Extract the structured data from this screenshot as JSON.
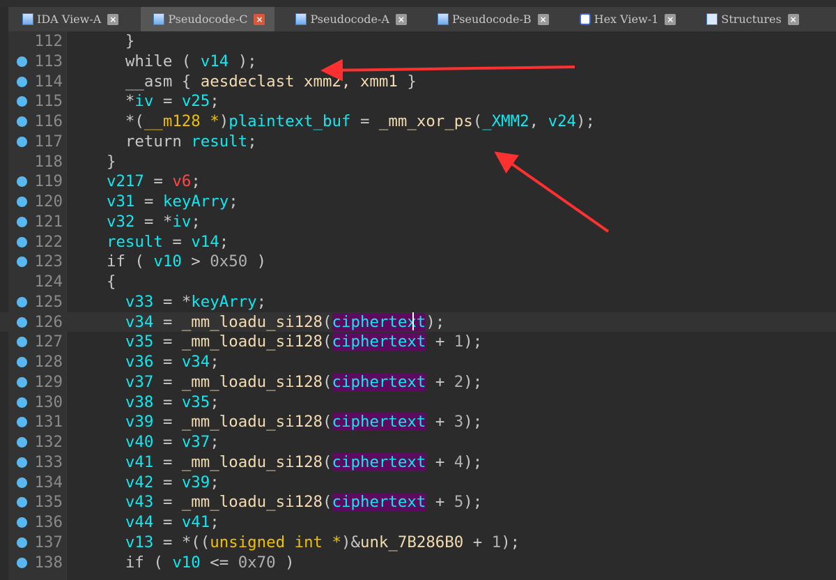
{
  "tabs": [
    {
      "label": "IDA View-A",
      "icon": "disassembly-icon",
      "active": false
    },
    {
      "label": "Pseudocode-C",
      "icon": "pseudocode-icon",
      "active": true
    },
    {
      "label": "Pseudocode-A",
      "icon": "pseudocode-icon",
      "active": false
    },
    {
      "label": "Pseudocode-B",
      "icon": "pseudocode-icon",
      "active": false
    },
    {
      "label": "Hex View-1",
      "icon": "hex-icon",
      "active": false
    },
    {
      "label": "Structures",
      "icon": "structures-icon",
      "active": false
    }
  ],
  "close_glyph": "×",
  "colors": {
    "background": "#2b2b2b",
    "variable": "#10e8f0",
    "function": "#f2dbb0",
    "type": "#f0c000",
    "highlight": "#5c0c5e",
    "breakpoint_dot": "#5ab8f0",
    "arrow": "#ff3030"
  },
  "current_line": 126,
  "lines": [
    {
      "num": "112",
      "dot": false,
      "indent": "    ",
      "tokens": [
        [
          "k",
          "}"
        ]
      ]
    },
    {
      "num": "113",
      "dot": true,
      "indent": "    ",
      "tokens": [
        [
          "k",
          "while ( "
        ],
        [
          "v",
          "v14"
        ],
        [
          "k",
          " );"
        ]
      ]
    },
    {
      "num": "114",
      "dot": true,
      "indent": "    ",
      "tokens": [
        [
          "k",
          "__asm { "
        ],
        [
          "f",
          "aesdeclast xmm2, xmm1"
        ],
        [
          "k",
          " }"
        ]
      ]
    },
    {
      "num": "115",
      "dot": true,
      "indent": "    ",
      "tokens": [
        [
          "k",
          "*"
        ],
        [
          "v",
          "iv"
        ],
        [
          "k",
          " = "
        ],
        [
          "v",
          "v25"
        ],
        [
          "k",
          ";"
        ]
      ]
    },
    {
      "num": "116",
      "dot": true,
      "indent": "    ",
      "tokens": [
        [
          "k",
          "*("
        ],
        [
          "t",
          "__m128 *"
        ],
        [
          "k",
          ")"
        ],
        [
          "v",
          "plaintext_buf"
        ],
        [
          "k",
          " = "
        ],
        [
          "f",
          "_mm_xor_ps"
        ],
        [
          "k",
          "("
        ],
        [
          "v",
          "_XMM2"
        ],
        [
          "k",
          ", "
        ],
        [
          "v",
          "v24"
        ],
        [
          "k",
          ");"
        ]
      ]
    },
    {
      "num": "117",
      "dot": true,
      "indent": "    ",
      "tokens": [
        [
          "k",
          "return "
        ],
        [
          "v",
          "result"
        ],
        [
          "k",
          ";"
        ]
      ]
    },
    {
      "num": "118",
      "dot": false,
      "indent": "  ",
      "tokens": [
        [
          "k",
          "}"
        ]
      ]
    },
    {
      "num": "119",
      "dot": true,
      "indent": "  ",
      "tokens": [
        [
          "v",
          "v217"
        ],
        [
          "k",
          " = "
        ],
        [
          "r",
          "v6"
        ],
        [
          "k",
          ";"
        ]
      ]
    },
    {
      "num": "120",
      "dot": true,
      "indent": "  ",
      "tokens": [
        [
          "v",
          "v31"
        ],
        [
          "k",
          " = "
        ],
        [
          "v",
          "keyArry"
        ],
        [
          "k",
          ";"
        ]
      ]
    },
    {
      "num": "121",
      "dot": true,
      "indent": "  ",
      "tokens": [
        [
          "v",
          "v32"
        ],
        [
          "k",
          " = *"
        ],
        [
          "v",
          "iv"
        ],
        [
          "k",
          ";"
        ]
      ]
    },
    {
      "num": "122",
      "dot": true,
      "indent": "  ",
      "tokens": [
        [
          "v",
          "result"
        ],
        [
          "k",
          " = "
        ],
        [
          "v",
          "v14"
        ],
        [
          "k",
          ";"
        ]
      ]
    },
    {
      "num": "123",
      "dot": true,
      "indent": "  ",
      "tokens": [
        [
          "k",
          "if ( "
        ],
        [
          "v",
          "v10"
        ],
        [
          "k",
          " > "
        ],
        [
          "n",
          "0x50"
        ],
        [
          "k",
          " )"
        ]
      ]
    },
    {
      "num": "124",
      "dot": false,
      "indent": "  ",
      "tokens": [
        [
          "k",
          "{"
        ]
      ]
    },
    {
      "num": "125",
      "dot": true,
      "indent": "    ",
      "tokens": [
        [
          "v",
          "v33"
        ],
        [
          "k",
          " = *"
        ],
        [
          "v",
          "keyArry"
        ],
        [
          "k",
          ";"
        ]
      ]
    },
    {
      "num": "126",
      "dot": true,
      "indent": "    ",
      "tokens": [
        [
          "v",
          "v34"
        ],
        [
          "k",
          " = "
        ],
        [
          "f",
          "_mm_loadu_si128"
        ],
        [
          "k",
          "("
        ],
        [
          "h",
          "ciphertext"
        ],
        [
          "k",
          ");"
        ]
      ]
    },
    {
      "num": "127",
      "dot": true,
      "indent": "    ",
      "tokens": [
        [
          "v",
          "v35"
        ],
        [
          "k",
          " = "
        ],
        [
          "f",
          "_mm_loadu_si128"
        ],
        [
          "k",
          "("
        ],
        [
          "h",
          "ciphertext"
        ],
        [
          "k",
          " + "
        ],
        [
          "n",
          "1"
        ],
        [
          "k",
          ");"
        ]
      ]
    },
    {
      "num": "128",
      "dot": true,
      "indent": "    ",
      "tokens": [
        [
          "v",
          "v36"
        ],
        [
          "k",
          " = "
        ],
        [
          "v",
          "v34"
        ],
        [
          "k",
          ";"
        ]
      ]
    },
    {
      "num": "129",
      "dot": true,
      "indent": "    ",
      "tokens": [
        [
          "v",
          "v37"
        ],
        [
          "k",
          " = "
        ],
        [
          "f",
          "_mm_loadu_si128"
        ],
        [
          "k",
          "("
        ],
        [
          "h",
          "ciphertext"
        ],
        [
          "k",
          " + "
        ],
        [
          "n",
          "2"
        ],
        [
          "k",
          ");"
        ]
      ]
    },
    {
      "num": "130",
      "dot": true,
      "indent": "    ",
      "tokens": [
        [
          "v",
          "v38"
        ],
        [
          "k",
          " = "
        ],
        [
          "v",
          "v35"
        ],
        [
          "k",
          ";"
        ]
      ]
    },
    {
      "num": "131",
      "dot": true,
      "indent": "    ",
      "tokens": [
        [
          "v",
          "v39"
        ],
        [
          "k",
          " = "
        ],
        [
          "f",
          "_mm_loadu_si128"
        ],
        [
          "k",
          "("
        ],
        [
          "h",
          "ciphertext"
        ],
        [
          "k",
          " + "
        ],
        [
          "n",
          "3"
        ],
        [
          "k",
          ");"
        ]
      ]
    },
    {
      "num": "132",
      "dot": true,
      "indent": "    ",
      "tokens": [
        [
          "v",
          "v40"
        ],
        [
          "k",
          " = "
        ],
        [
          "v",
          "v37"
        ],
        [
          "k",
          ";"
        ]
      ]
    },
    {
      "num": "133",
      "dot": true,
      "indent": "    ",
      "tokens": [
        [
          "v",
          "v41"
        ],
        [
          "k",
          " = "
        ],
        [
          "f",
          "_mm_loadu_si128"
        ],
        [
          "k",
          "("
        ],
        [
          "h",
          "ciphertext"
        ],
        [
          "k",
          " + "
        ],
        [
          "n",
          "4"
        ],
        [
          "k",
          ");"
        ]
      ]
    },
    {
      "num": "134",
      "dot": true,
      "indent": "    ",
      "tokens": [
        [
          "v",
          "v42"
        ],
        [
          "k",
          " = "
        ],
        [
          "v",
          "v39"
        ],
        [
          "k",
          ";"
        ]
      ]
    },
    {
      "num": "135",
      "dot": true,
      "indent": "    ",
      "tokens": [
        [
          "v",
          "v43"
        ],
        [
          "k",
          " = "
        ],
        [
          "f",
          "_mm_loadu_si128"
        ],
        [
          "k",
          "("
        ],
        [
          "h",
          "ciphertext"
        ],
        [
          "k",
          " + "
        ],
        [
          "n",
          "5"
        ],
        [
          "k",
          ");"
        ]
      ]
    },
    {
      "num": "136",
      "dot": true,
      "indent": "    ",
      "tokens": [
        [
          "v",
          "v44"
        ],
        [
          "k",
          " = "
        ],
        [
          "v",
          "v41"
        ],
        [
          "k",
          ";"
        ]
      ]
    },
    {
      "num": "137",
      "dot": true,
      "indent": "    ",
      "tokens": [
        [
          "v",
          "v13"
        ],
        [
          "k",
          " = *(("
        ],
        [
          "t",
          "unsigned int *"
        ],
        [
          "k",
          ")&"
        ],
        [
          "f",
          "unk_7B286B0"
        ],
        [
          "k",
          " + "
        ],
        [
          "n",
          "1"
        ],
        [
          "k",
          ");"
        ]
      ]
    },
    {
      "num": "138",
      "dot": true,
      "indent": "    ",
      "tokens": [
        [
          "k",
          "if ( "
        ],
        [
          "v",
          "v10"
        ],
        [
          "k",
          " <= "
        ],
        [
          "n",
          "0x70"
        ],
        [
          "k",
          " )"
        ]
      ]
    }
  ]
}
